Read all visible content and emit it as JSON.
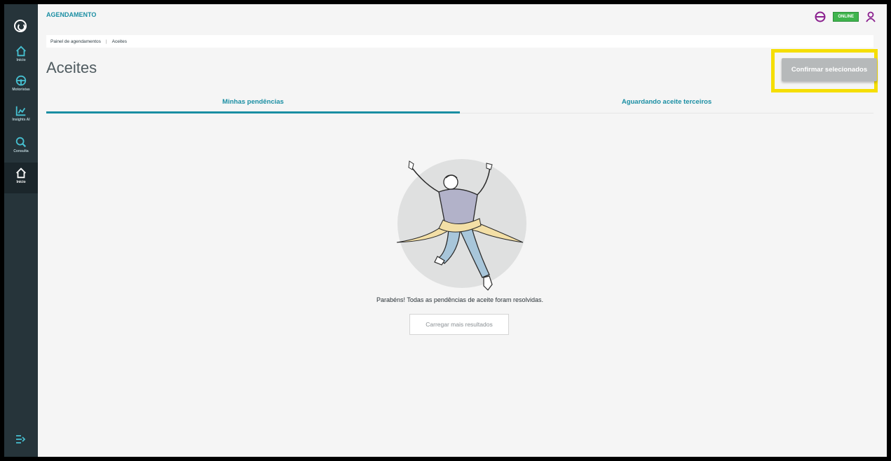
{
  "app": {
    "title": "AGENDAMENTO",
    "status": "ONLINE"
  },
  "sidebar": {
    "items": [
      {
        "label": "Início",
        "icon": "home-icon"
      },
      {
        "label": "Motoristas",
        "icon": "steering-wheel-icon"
      },
      {
        "label": "Insights AI",
        "icon": "chart-icon"
      },
      {
        "label": "Consulta",
        "icon": "search-icon"
      },
      {
        "label": "Início",
        "icon": "home-icon"
      }
    ],
    "exit_icon": "logout-icon"
  },
  "breadcrumb": {
    "items": [
      "Painel de agendamentos",
      "Aceites"
    ]
  },
  "page": {
    "title": "Aceites"
  },
  "toolbar": {
    "confirm_label": "Confirmar selecionados"
  },
  "tabs": [
    {
      "label": "Minhas pendências",
      "active": true
    },
    {
      "label": "Aguardando aceite terceiros",
      "active": false
    }
  ],
  "empty_state": {
    "message": "Parabéns! Todas as pendências de aceite foram resolvidas.",
    "load_more_label": "Carregar mais resultados"
  },
  "colors": {
    "accent": "#1a8ea3",
    "sidebar": "#26343a",
    "online": "#3fb44d",
    "highlight": "#f5de03"
  }
}
